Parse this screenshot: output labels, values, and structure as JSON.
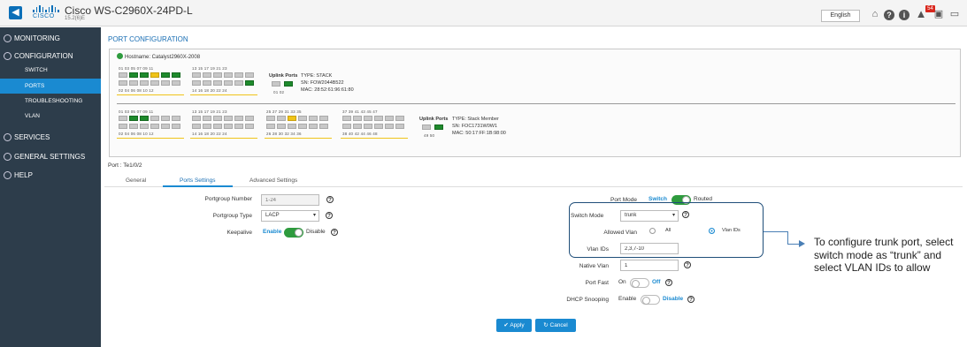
{
  "header": {
    "logo_text": "CISCO",
    "device_title": "Cisco WS-C2960X-24PD-L",
    "device_subtitle": "15.2(6)E",
    "language": "English",
    "alert_count": "54",
    "icons": [
      "home-icon",
      "help-icon",
      "info-icon",
      "alert-icon",
      "save-icon",
      "monitor-icon"
    ]
  },
  "sidebar": {
    "monitoring": "MONITORING",
    "configuration": "CONFIGURATION",
    "sub_items": [
      "SWITCH",
      "PORTS",
      "TROUBLESHOOTING",
      "VLAN"
    ],
    "services": "SERVICES",
    "general_settings": "GENERAL SETTINGS",
    "help": "HELP"
  },
  "page": {
    "title": "PORT CONFIGURATION"
  },
  "stack": {
    "hostname": "Hostname: Catalyst2960X-2008",
    "switch1": {
      "top_nums_a": "01  03  05  07  09  11",
      "bottom_nums_a": "02  04  06  08  10  12",
      "top_nums_b": "13  15  17  19  21  23",
      "bottom_nums_b": "14  16  18  20  22  24",
      "uplink_label": "Uplink Ports",
      "uplink_nums": "01    02",
      "type": "TYPE: STACK",
      "sn": "SN: FOW2044B522",
      "mac": "MAC: 28:52:61:96:61:80"
    },
    "switch2": {
      "top_nums_a": "01  03  05  07  09  11",
      "bottom_nums_a": "02  04  06  08  10  12",
      "top_nums_b": "13  15  17  19  21  23",
      "bottom_nums_b": "14  16  18  20  22  24",
      "top_nums_c": "25  27  29  31  33  35",
      "bottom_nums_c": "26  28  30  32  34  36",
      "top_nums_d": "37  39  41  43  45  47",
      "bottom_nums_d": "38  40  42  44  46  48",
      "uplink_label": "Uplink Ports",
      "uplink_nums": "49    50",
      "type": "TYPE: Stack Member",
      "sn": "SN: FOC1731W0W1",
      "mac": "MAC: 50:17:FF:1B:98:00"
    }
  },
  "port": {
    "name": "Port : Te1/0/2",
    "tabs": [
      "General",
      "Ports Settings",
      "Advanced Settings"
    ]
  },
  "form": {
    "portgroup_number_label": "Portgroup Number",
    "portgroup_number_placeholder": "1-24",
    "portgroup_type_label": "Portgroup Type",
    "portgroup_type_value": "LACP",
    "keepalive_label": "Keepalive",
    "keepalive_on": "Enable",
    "keepalive_off": "Disable",
    "port_mode_label": "Port Mode",
    "port_mode_switch": "Switch",
    "port_mode_routed": "Routed",
    "switch_mode_label": "Switch Mode",
    "switch_mode_value": "trunk",
    "allowed_vlan_label": "Allowed Vlan",
    "allowed_vlan_all": "All",
    "allowed_vlan_ids": "Vlan IDs",
    "vlan_ids_label": "Vlan IDs",
    "vlan_ids_value": "2,3,7-10",
    "native_vlan_label": "Native Vlan",
    "native_vlan_value": "1",
    "port_fast_label": "Port Fast",
    "port_fast_on": "On",
    "port_fast_off": "Off",
    "dhcp_label": "DHCP Snooping",
    "dhcp_on": "Enable",
    "dhcp_off": "Disable",
    "apply": "✔ Apply",
    "cancel": "↻ Cancel"
  },
  "annotation": {
    "text": "To configure trunk port, select switch mode as “trunk” and select VLAN IDs to allow"
  }
}
